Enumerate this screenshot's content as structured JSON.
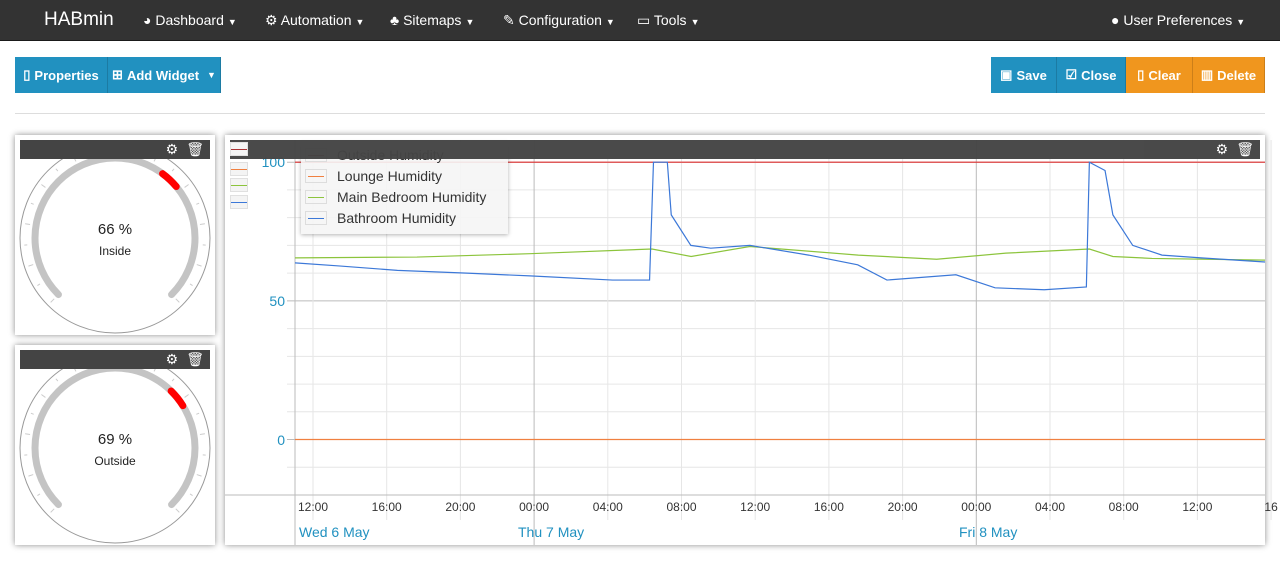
{
  "nav": {
    "brand": "HABmin",
    "items": [
      {
        "label": "Dashboard",
        "icon": "dashboard-icon"
      },
      {
        "label": "Automation",
        "icon": "cogs-icon"
      },
      {
        "label": "Sitemaps",
        "icon": "sitemap-icon"
      },
      {
        "label": "Configuration",
        "icon": "wrench-icon"
      },
      {
        "label": "Tools",
        "icon": "laptop-icon"
      }
    ],
    "user": "User Preferences"
  },
  "toolbar": {
    "properties": "Properties",
    "add_widget": "Add Widget",
    "save": "Save",
    "close": "Close",
    "clear": "Clear",
    "delete": "Delete"
  },
  "gauges": [
    {
      "value": 66,
      "unit": "%",
      "label": "Inside",
      "value_text": "66 %"
    },
    {
      "value": 69,
      "unit": "%",
      "label": "Outside",
      "value_text": "69 %"
    }
  ],
  "colors": {
    "primary": "#2191c0",
    "warning": "#f0961e",
    "gauge_marker": "#ff0000"
  },
  "chart_data": {
    "type": "line",
    "x_range": [
      "06 May 11:00",
      "08 May 16:40"
    ],
    "ylim": [
      -20,
      108
    ],
    "y_ticks": [
      0,
      50,
      100
    ],
    "x_ticks": [
      "12:00",
      "16:00",
      "20:00",
      "00:00",
      "04:00",
      "08:00",
      "12:00",
      "16:00",
      "20:00",
      "00:00",
      "04:00",
      "08:00",
      "12:00",
      "16"
    ],
    "date_labels": [
      "Wed 6 May",
      "Thu 7 May",
      "Fri 8 May"
    ],
    "grid": true,
    "legend_position": "top-left",
    "series": [
      {
        "name": "Outside Humidity",
        "color": "#e03030",
        "points": [
          [
            "06 May 11:00",
            100
          ],
          [
            "08 May 16:40",
            100
          ]
        ]
      },
      {
        "name": "Lounge Humidity",
        "color": "#f08040",
        "points": [
          [
            "06 May 11:00",
            0
          ],
          [
            "08 May 16:40",
            0
          ]
        ]
      },
      {
        "name": "Main Bedroom Humidity",
        "color": "#8cc43c",
        "points": [
          [
            "06 May 11:00",
            65.5
          ],
          [
            "06 May 17:45",
            65.8
          ],
          [
            "07 May 00:00",
            67
          ],
          [
            "07 May 06:45",
            68.7
          ],
          [
            "07 May 08:55",
            66
          ],
          [
            "07 May 12:10",
            69.6
          ],
          [
            "07 May 18:10",
            66.5
          ],
          [
            "07 May 22:30",
            65
          ],
          [
            "08 May 02:20",
            67.2
          ],
          [
            "08 May 06:57",
            68.7
          ],
          [
            "08 May 08:15",
            66
          ],
          [
            "08 May 10:25",
            65.3
          ],
          [
            "08 May 16:40",
            64.7
          ]
        ]
      },
      {
        "name": "Bathroom Humidity",
        "color": "#3c78d8",
        "points": [
          [
            "06 May 11:00",
            63.7
          ],
          [
            "06 May 13:26",
            62.6
          ],
          [
            "06 May 16:40",
            61
          ],
          [
            "06 May 20:30",
            60
          ],
          [
            "07 May 00:00",
            59
          ],
          [
            "07 May 04:34",
            57.5
          ],
          [
            "07 May 06:37",
            57.5
          ],
          [
            "07 May 06:50",
            100
          ],
          [
            "07 May 07:36",
            100
          ],
          [
            "07 May 07:49",
            81
          ],
          [
            "07 May 08:54",
            70
          ],
          [
            "07 May 10:00",
            69
          ],
          [
            "07 May 12:10",
            70
          ],
          [
            "07 May 15:25",
            66.5
          ],
          [
            "07 May 18:08",
            63
          ],
          [
            "07 May 19:45",
            57.5
          ],
          [
            "07 May 23:34",
            59.4
          ],
          [
            "08 May 01:44",
            54.7
          ],
          [
            "08 May 04:27",
            54
          ],
          [
            "08 May 06:47",
            55
          ],
          [
            "08 May 06:57",
            100
          ],
          [
            "08 May 07:49",
            97
          ],
          [
            "08 May 08:15",
            81
          ],
          [
            "08 May 09:21",
            70
          ],
          [
            "08 May 10:58",
            66.5
          ],
          [
            "08 May 13:08",
            65.5
          ],
          [
            "08 May 16:40",
            64
          ]
        ]
      }
    ]
  }
}
